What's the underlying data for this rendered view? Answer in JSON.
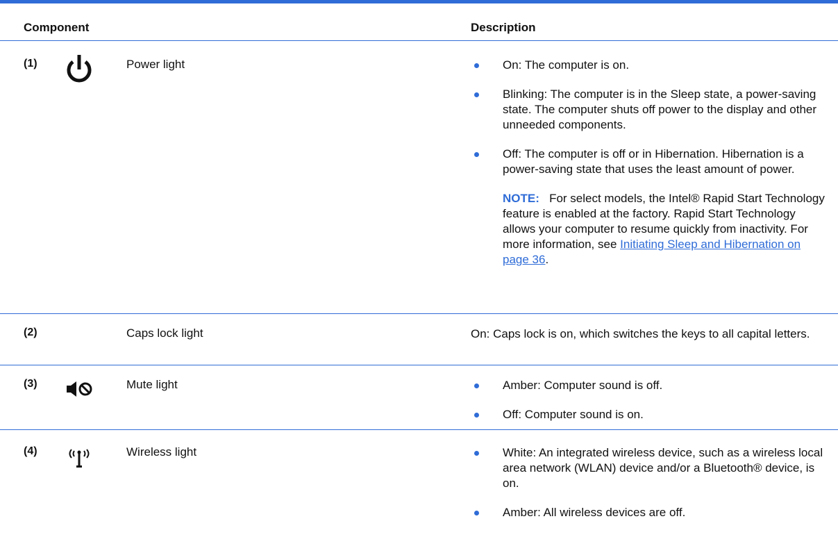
{
  "header": {
    "component": "Component",
    "description": "Description"
  },
  "rows": [
    {
      "number": "(1)",
      "icon": "power-icon",
      "name": "Power light",
      "bullets": [
        "On: The computer is on.",
        "Blinking: The computer is in the Sleep state, a power-saving state. The computer shuts off power to the display and other unneeded components.",
        "Off: The computer is off or in Hibernation. Hibernation is a power-saving state that uses the least amount of power."
      ],
      "note": {
        "label": "NOTE:",
        "text": "For select models, the Intel® Rapid Start Technology feature is enabled at the factory. Rapid Start Technology allows your computer to resume quickly from inactivity. For more information, see ",
        "link": "Initiating Sleep and Hibernation on page 36",
        "after": "."
      }
    },
    {
      "number": "(2)",
      "icon": "",
      "name": "Caps lock light",
      "text": "On: Caps lock is on, which switches the keys to all capital letters."
    },
    {
      "number": "(3)",
      "icon": "mute-icon",
      "name": "Mute light",
      "bullets": [
        "Amber: Computer sound is off.",
        "Off: Computer sound is on."
      ]
    },
    {
      "number": "(4)",
      "icon": "wireless-icon",
      "name": "Wireless light",
      "bullets": [
        "White: An integrated wireless device, such as a wireless local area network (WLAN) device and/or a Bluetooth® device, is on.",
        "Amber: All wireless devices are off."
      ]
    }
  ],
  "colors": {
    "accent": "#2f6cd7",
    "text": "#111111"
  }
}
